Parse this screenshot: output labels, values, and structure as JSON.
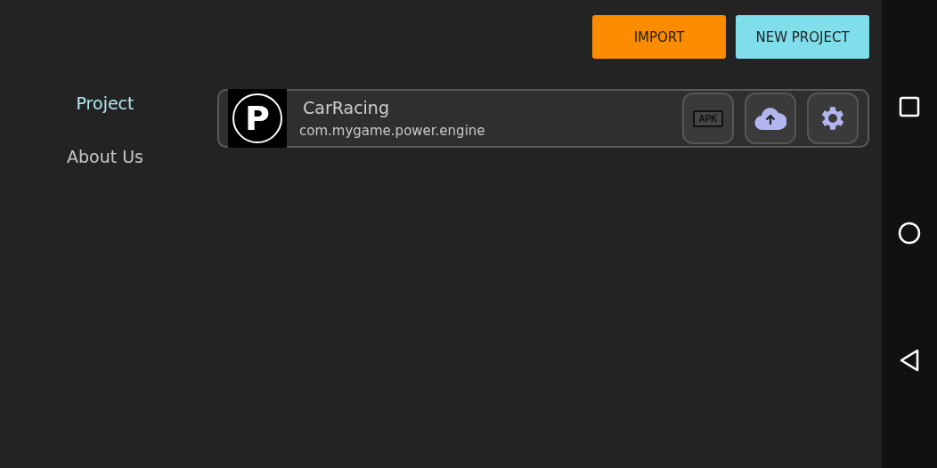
{
  "toolbar": {
    "buttons": [
      {
        "label": "IMPORT",
        "kind": "primary"
      },
      {
        "label": "NEW PROJECT",
        "kind": "secondary"
      }
    ]
  },
  "sidebar": {
    "items": [
      {
        "label": "Project",
        "selected": true
      },
      {
        "label": "About Us",
        "selected": false
      }
    ]
  },
  "projects": [
    {
      "logo": "P",
      "name": "CarRacing",
      "package": "com.mygame.power.engine",
      "actions": [
        {
          "kind": "apk",
          "label": "APK"
        },
        {
          "kind": "upload"
        },
        {
          "kind": "settings"
        }
      ]
    }
  ]
}
